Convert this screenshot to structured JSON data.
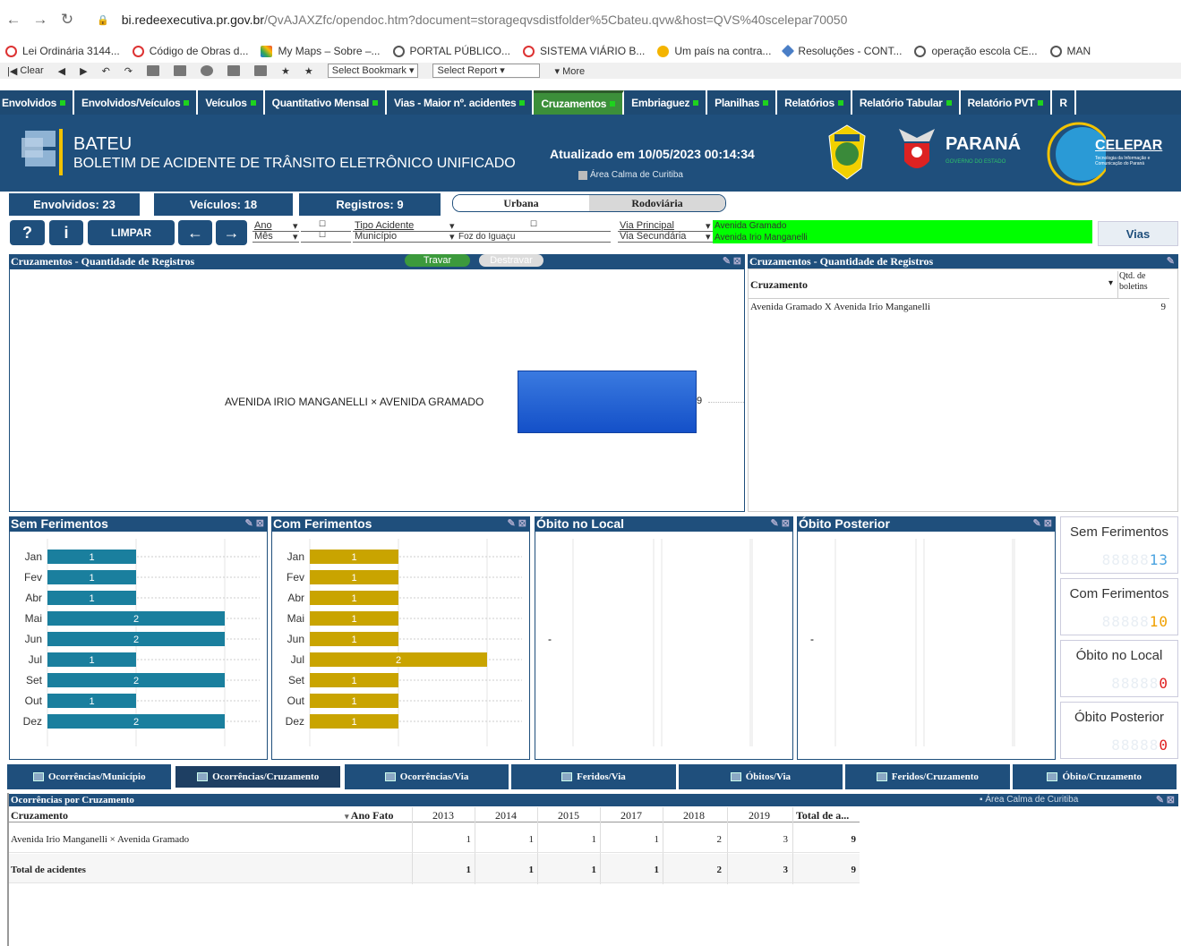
{
  "browser": {
    "url_host": "bi.redeexecutiva.pr.gov.br",
    "url_path": "/QvAJAXZfc/opendoc.htm?document=storageqvsdistfolder%5Cbateu.qvw&host=QVS%40scelepar70050",
    "bookmarks": [
      {
        "label": "Lei Ordinária 3144...",
        "icon": "circle-red-icon"
      },
      {
        "label": "Código de Obras d...",
        "icon": "circle-red-icon"
      },
      {
        "label": "My Maps – Sobre –...",
        "icon": "maps-icon"
      },
      {
        "label": "PORTAL PÚBLICO...",
        "icon": "globe-icon"
      },
      {
        "label": "SISTEMA VIÁRIO B...",
        "icon": "circle-red-icon"
      },
      {
        "label": "Um país na contra...",
        "icon": "yellow-icon"
      },
      {
        "label": "Resoluções - CONT...",
        "icon": "diamond-icon"
      },
      {
        "label": "operação escola CE...",
        "icon": "globe-icon"
      },
      {
        "label": "MAN",
        "icon": "globe-icon"
      }
    ]
  },
  "qv_toolbar": {
    "clear": "Clear",
    "bookmark": "Select Bookmark",
    "report": "Select Report",
    "more": "More"
  },
  "tabs": [
    {
      "label": "Envolvidos",
      "active": false
    },
    {
      "label": "Envolvidos/Veículos",
      "active": false
    },
    {
      "label": "Veículos",
      "active": false
    },
    {
      "label": "Quantitativo Mensal",
      "active": false
    },
    {
      "label": "Vias - Maior nº. acidentes",
      "active": false
    },
    {
      "label": "Cruzamentos",
      "active": true
    },
    {
      "label": "Embriaguez",
      "active": false
    },
    {
      "label": "Planilhas",
      "active": false
    },
    {
      "label": "Relatórios",
      "active": false
    },
    {
      "label": "Relatório Tabular",
      "active": false
    },
    {
      "label": "Relatório PVT",
      "active": false
    },
    {
      "label": "R",
      "active": false
    }
  ],
  "header": {
    "title": "BATEU",
    "subtitle": "BOLETIM DE ACIDENTE DE TRÂNSITO ELETRÔNICO UNIFICADO",
    "updated": "Atualizado em 10/05/2023 00:14:34",
    "calm_area": "Área Calma de Curitiba",
    "state": "PARANÁ",
    "state_sub": "GOVERNO DO ESTADO",
    "celepar": "CELEPAR",
    "celepar_sub": "Tecnologia da Informação e Comunicação do Paraná",
    "celepar_color": "#2a9ad6",
    "header_color": "#1f4f7c"
  },
  "counters": {
    "envolvidos": "Envolvidos: 23",
    "veiculos": "Veículos: 18",
    "registros": "Registros: 9",
    "urbana": "Urbana",
    "rodoviaria": "Rodoviária"
  },
  "filters": {
    "help": "?",
    "info": "i",
    "clear": "LIMPAR",
    "back": "←",
    "forward": "→",
    "ano": "Ano",
    "mes": "Mês",
    "tipo_acidente": "Tipo Acidente",
    "municipio": "Município",
    "municipio_value": "Foz do Iguaçu",
    "via_principal": "Via Principal",
    "via_principal_value": "Avenida Gramado",
    "via_secundaria": "Via Secundária",
    "via_secundaria_value": "Avenida Irio Manganelli",
    "vias_button": "Vias"
  },
  "main_chart": {
    "title": "Cruzamentos - Quantidade de Registros",
    "lock": "Travar",
    "unlock": "Destravar",
    "label": "AVENIDA IRIO MANGANELLI × AVENIDA GRAMADO",
    "value": 9,
    "value_label": "9"
  },
  "table_panel": {
    "title": "Cruzamentos - Quantidade de Registros",
    "col_cruzamento": "Cruzamento",
    "col_qtd": "Qtd. de boletins",
    "rows": [
      {
        "name": "Avenida Gramado X Avenida Irio Manganelli",
        "qtd": "9"
      }
    ]
  },
  "chart_data": [
    {
      "type": "bar",
      "title": "Sem Ferimentos",
      "categories": [
        "Jan",
        "Fev",
        "Abr",
        "Mai",
        "Jun",
        "Jul",
        "Set",
        "Out",
        "Dez"
      ],
      "values": [
        1,
        1,
        1,
        2,
        2,
        1,
        2,
        1,
        2
      ],
      "color": "#1a7f9e"
    },
    {
      "type": "bar",
      "title": "Com Ferimentos",
      "categories": [
        "Jan",
        "Fev",
        "Abr",
        "Mai",
        "Jun",
        "Jul",
        "Set",
        "Out",
        "Dez"
      ],
      "values": [
        1,
        1,
        1,
        1,
        1,
        2,
        1,
        1,
        1
      ],
      "color": "#c9a400"
    },
    {
      "type": "bar",
      "title": "Óbito no Local",
      "categories": [],
      "values": [],
      "placeholder": "-"
    },
    {
      "type": "bar",
      "title": "Óbito Posterior",
      "categories": [],
      "values": [],
      "placeholder": "-"
    }
  ],
  "kpis": [
    {
      "label": "Sem Ferimentos",
      "ghost": "88888",
      "value": "13",
      "color": "#4aa3e0"
    },
    {
      "label": "Com Ferimentos",
      "ghost": "88888",
      "value": "10",
      "color": "#f0a000"
    },
    {
      "label": "Óbito no Local",
      "ghost": "88888",
      "value": "0",
      "color": "#e02020"
    },
    {
      "label": "Óbito Posterior",
      "ghost": "88888",
      "value": "0",
      "color": "#e02020"
    }
  ],
  "bottom_tabs": [
    {
      "label": "Ocorrências/Município",
      "active": false
    },
    {
      "label": "Ocorrências/Cruzamento",
      "active": true
    },
    {
      "label": "Ocorrências/Via",
      "active": false
    },
    {
      "label": "Feridos/Via",
      "active": false
    },
    {
      "label": "Óbitos/Via",
      "active": false
    },
    {
      "label": "Feridos/Cruzamento",
      "active": false
    },
    {
      "label": "Óbito/Cruzamento",
      "active": false
    }
  ],
  "pivot": {
    "title": "Ocorrências por Cruzamento",
    "calm_area": "Área Calma de Curitiba",
    "col_cruzamento": "Cruzamento",
    "col_ano": "Ano Fato",
    "years": [
      "2013",
      "2014",
      "2015",
      "2017",
      "2018",
      "2019",
      "Total de a..."
    ],
    "rows": [
      {
        "name": "Avenida Irio Manganelli × Avenida Gramado",
        "values": [
          "1",
          "1",
          "1",
          "1",
          "2",
          "3",
          "9"
        ]
      },
      {
        "name": "Total de acidentes",
        "values": [
          "1",
          "1",
          "1",
          "1",
          "2",
          "3",
          "9"
        ]
      }
    ]
  }
}
